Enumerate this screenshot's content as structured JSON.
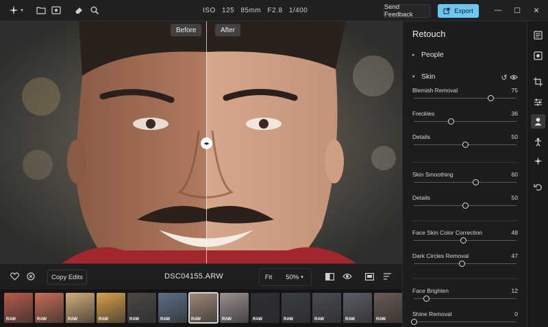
{
  "topbar": {
    "camera_info": "ISO 125  85mm  F2.8  1/400",
    "feedback_label": "Send Feedback",
    "export_label": "Export"
  },
  "viewer": {
    "before_label": "Before",
    "after_label": "After",
    "split_position": 0.513
  },
  "bottombar": {
    "copy_edits_label": "Copy Edits",
    "filename": "DSC04155.ARW",
    "fit_label": "Fit",
    "zoom_value": "50%"
  },
  "filmstrip": {
    "raw_label": "RAW",
    "thumbnails": [
      {
        "color": "#b85a4a",
        "raw": true
      },
      {
        "color": "#c86d55",
        "raw": true
      },
      {
        "color": "#d2b078",
        "raw": true
      },
      {
        "color": "#d8a24a",
        "raw": true
      },
      {
        "color": "#4a4744",
        "raw": true
      },
      {
        "color": "#5c6f86",
        "raw": true
      },
      {
        "color": "#a08878",
        "raw": true,
        "selected": true
      },
      {
        "color": "#9c8f90",
        "raw": true
      },
      {
        "color": "#2c2e34",
        "raw": true
      },
      {
        "color": "#3a3d44",
        "raw": true
      },
      {
        "color": "#484b52",
        "raw": true
      },
      {
        "color": "#5a5e66",
        "raw": true
      },
      {
        "color": "#6b5a52",
        "raw": true
      }
    ]
  },
  "panel": {
    "title": "Retouch",
    "people_label": "People",
    "skin_label": "Skin",
    "sliders": [
      {
        "label": "Blemish Removal",
        "value": "75",
        "fraction": 0.75
      },
      {
        "label": "Freckles",
        "value": "36",
        "fraction": 0.36
      },
      {
        "label": "Details",
        "value": "50",
        "fraction": 0.5
      },
      {
        "label": "Skin Smoothing",
        "value": "60",
        "fraction": 0.6
      },
      {
        "label": "Details",
        "value": "50",
        "fraction": 0.5
      },
      {
        "label": "Face Skin Color Correction",
        "value": "48",
        "fraction": 0.48
      },
      {
        "label": "Dark Circles Removal",
        "value": "47",
        "fraction": 0.47
      },
      {
        "label": "Face Brighten",
        "value": "12",
        "fraction": 0.12
      },
      {
        "label": "Shine Removal",
        "value": "0",
        "fraction": 0.0
      }
    ]
  },
  "colors": {
    "accent": "#6bc6f0",
    "background": "#1b1b1d"
  }
}
